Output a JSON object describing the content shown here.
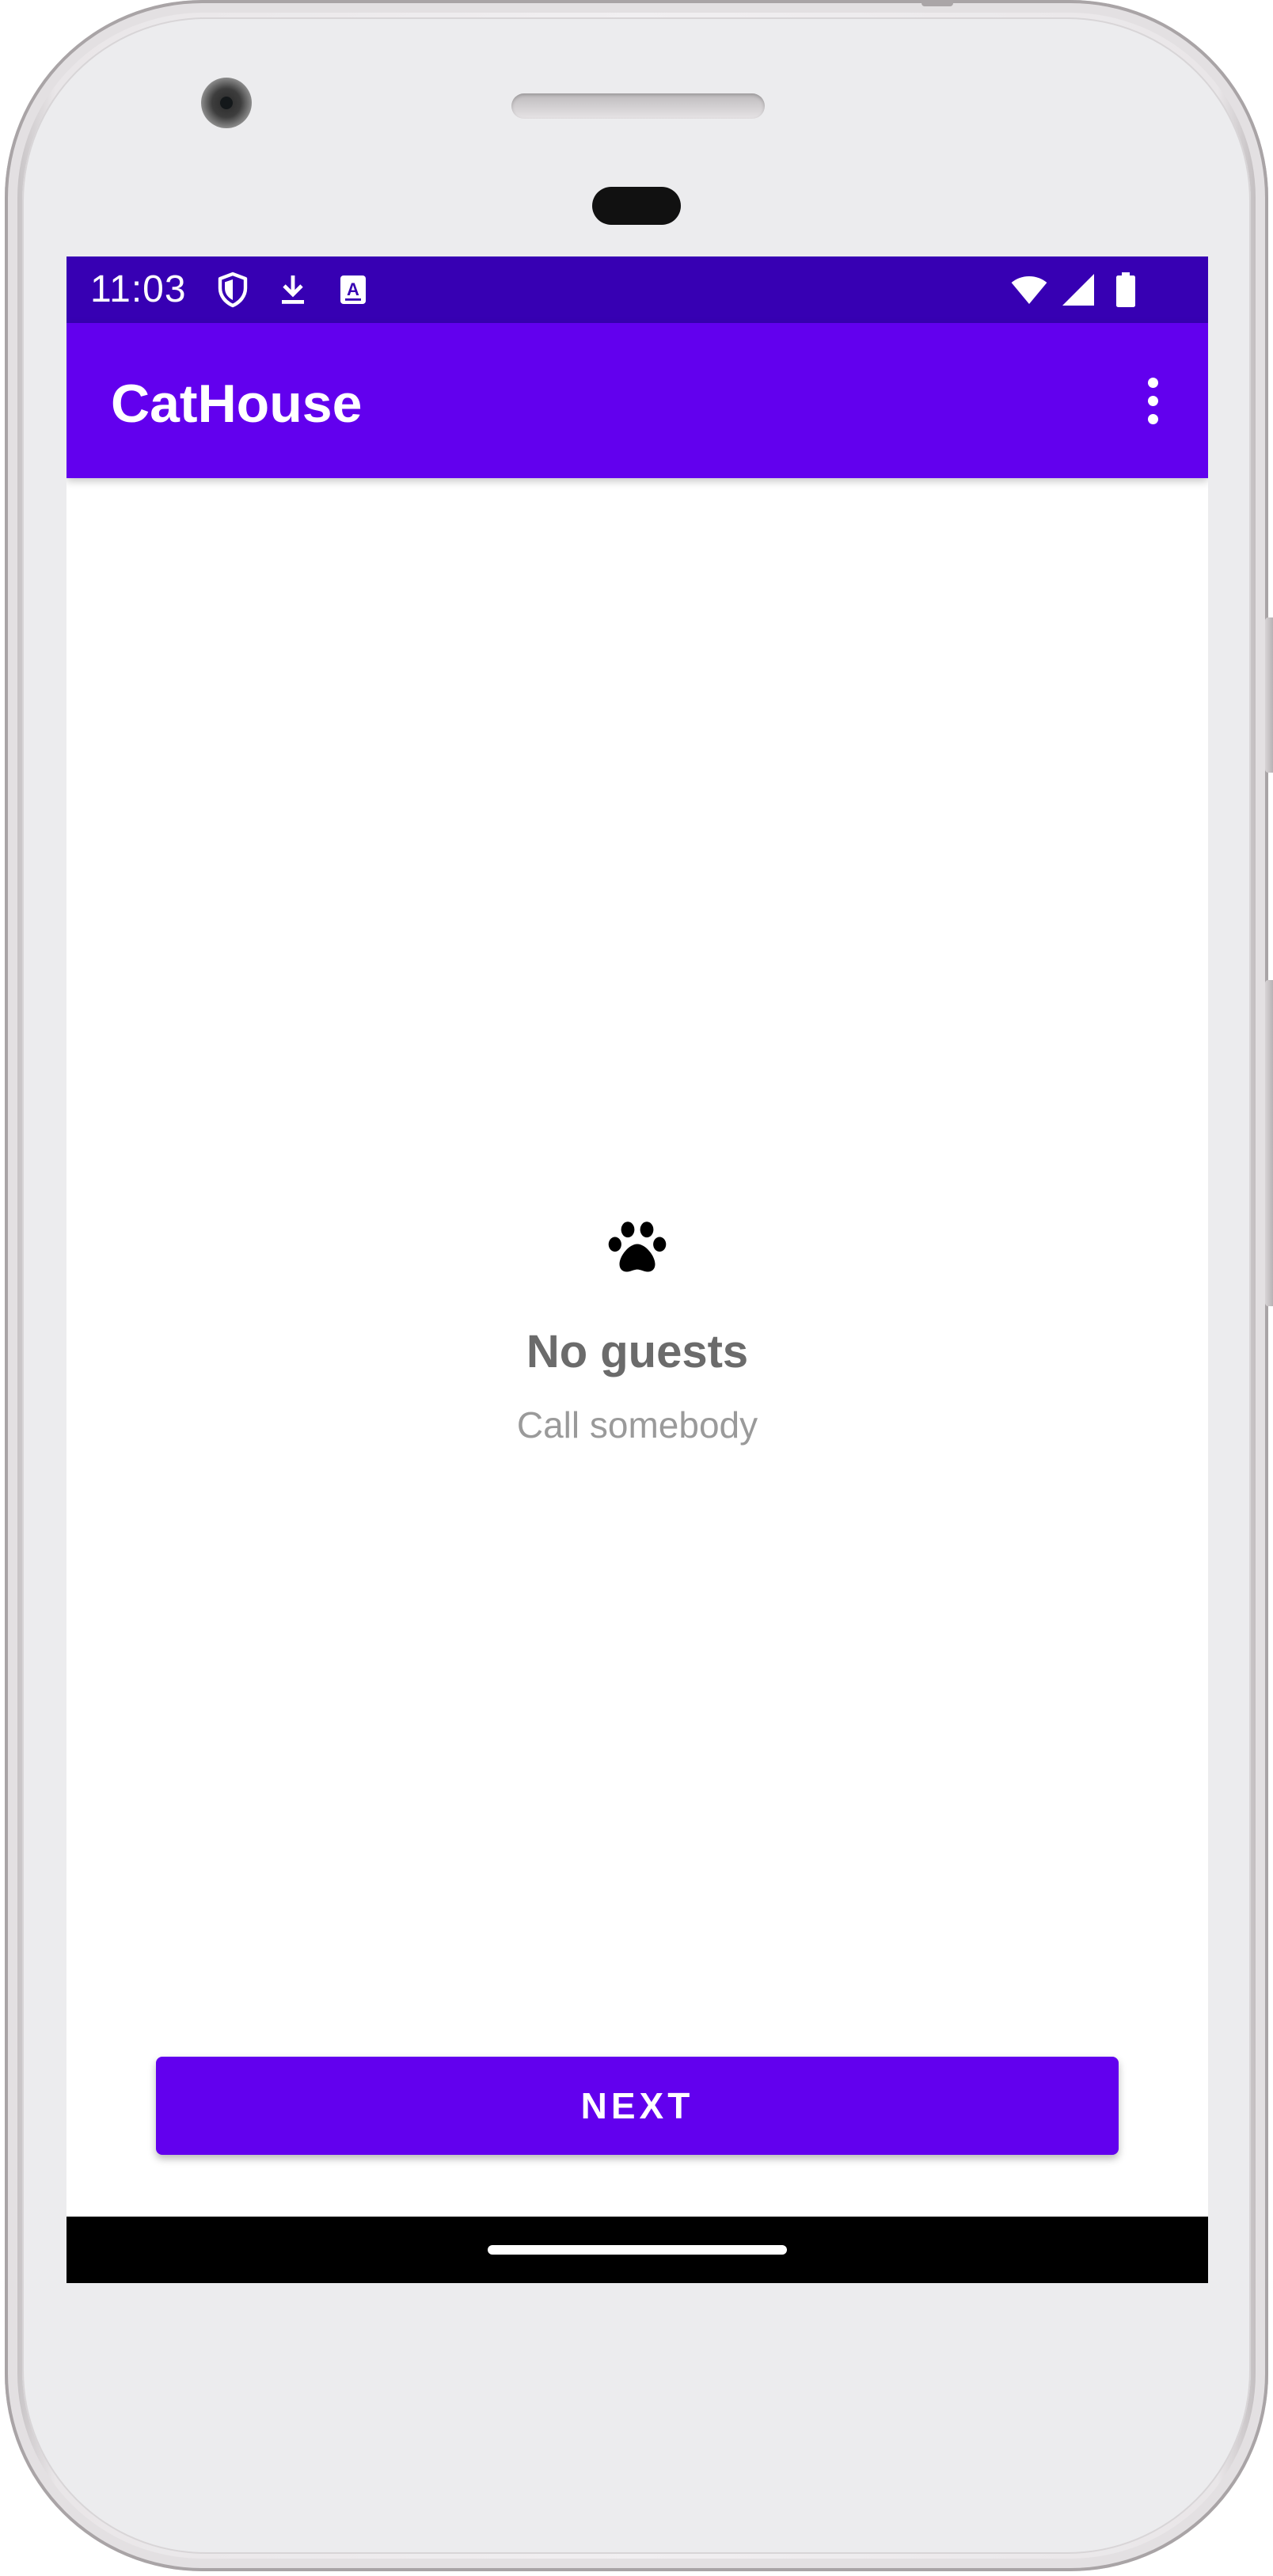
{
  "status_bar": {
    "time": "11:03",
    "left_icons": [
      "shield-icon",
      "download-icon",
      "text-a-icon"
    ],
    "right_icons": [
      "wifi-icon",
      "cell-signal-icon",
      "battery-icon"
    ]
  },
  "app_bar": {
    "title": "CatHouse",
    "overflow_icon": "more-vertical-icon"
  },
  "empty_state": {
    "icon": "paw-icon",
    "title": "No guests",
    "subtitle": "Call somebody"
  },
  "actions": {
    "next_label": "NEXT"
  },
  "colors": {
    "primary": "#6200ee",
    "primary_dark": "#3700b3",
    "title_text": "#6b6b6b",
    "subtitle_text": "#9a9a9a"
  }
}
